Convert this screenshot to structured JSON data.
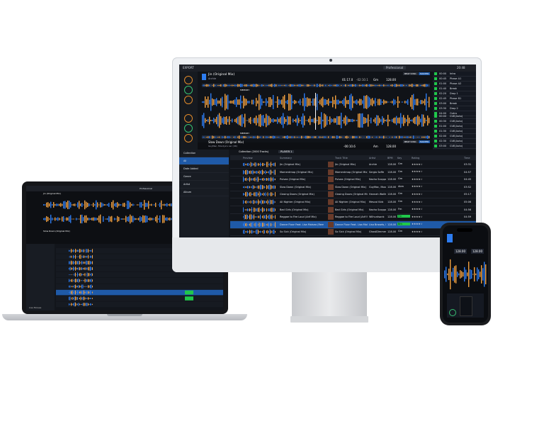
{
  "monitor": {
    "toolbar": {
      "export_label": "EXPORT",
      "mode": "Professional",
      "time": "20:48"
    },
    "deck1": {
      "title": "Jin (Original Mix)",
      "artist": "Archie",
      "elapsed": "01:17.0",
      "remain": "-02:10.1",
      "key": "Gm",
      "bpm": "128.00",
      "beat_sync": "BEAT SYNC",
      "master": "MASTER",
      "memory": "MEMORY",
      "cue": "CUE"
    },
    "deck2": {
      "title": "Slow Down (Original Mix)",
      "artist": "GuyMac, Moodys's Lar (UK)",
      "elapsed": "-00:10.6",
      "key": "Am",
      "bpm": "128.00",
      "beat_sync": "BEAT SYNC",
      "master": "MASTER",
      "memory": "MEMORY"
    },
    "hot_cues": [
      {
        "time": "00:00",
        "label": "Intro"
      },
      {
        "time": "00:45",
        "label": "Phase A1"
      },
      {
        "time": "01:00",
        "label": "Phase A2"
      },
      {
        "time": "01:40",
        "label": "Break"
      },
      {
        "time": "02:20",
        "label": "Drop 1"
      },
      {
        "time": "02:45",
        "label": "Phase B1"
      },
      {
        "time": "03:00",
        "label": "Break"
      },
      {
        "time": "03:30",
        "label": "Drop 2"
      },
      {
        "time": "04:00",
        "label": "Outro"
      }
    ],
    "hot_cues_b": [
      {
        "time": "00:00",
        "label": "CUE(Auto)"
      },
      {
        "time": "00:30",
        "label": "CUE(Auto)"
      },
      {
        "time": "01:00",
        "label": "CUE(Auto)"
      },
      {
        "time": "01:30",
        "label": "CUE(Auto)"
      },
      {
        "time": "02:00",
        "label": "CUE(Auto)"
      },
      {
        "time": "02:30",
        "label": "CUE(Auto)"
      },
      {
        "time": "03:00",
        "label": "CUE(Auto)"
      }
    ],
    "browser": {
      "tree_items": [
        "Collection",
        "All",
        "Date Added",
        "Genre",
        "Artist",
        "Album"
      ],
      "header": "Collection (2000 Tracks)",
      "player_label": "PLAYER 1",
      "columns": [
        "Preview",
        "Summary",
        "Track Title",
        "Artist",
        "BPM",
        "Key",
        "Rating",
        "Time"
      ],
      "rows": [
        {
          "summary": "Jin (Original Mix)",
          "title": "Jin (Original Mix)",
          "artist": "Archie",
          "bpm": "128.00",
          "key": "Gm",
          "time": "03:31"
        },
        {
          "summary": "Momentmap (Original Mix)",
          "title": "Momentmap (Original Mix)",
          "artist": "Sergio Saffe",
          "bpm": "128.00",
          "key": "Gm",
          "time": "04:57"
        },
        {
          "summary": "Pulsea (Original Mix)",
          "title": "Pulsea (Original Mix)",
          "artist": "Nacho Scoppa",
          "bpm": "128.00",
          "key": "Gm",
          "time": "04:45"
        },
        {
          "summary": "Slow Down (Original Mix)",
          "title": "Slow Down (Original Mix)",
          "artist": "GuyMac, Moodys's L",
          "bpm": "128.00",
          "key": "Abm",
          "time": "03:52"
        },
        {
          "summary": "Closing Doors (Original Mix)",
          "title": "Closing Doors (Original Mix)",
          "artist": "Hannah Wallis",
          "bpm": "128.00",
          "key": "Gm",
          "time": "05:17"
        },
        {
          "summary": "All Nighter (Original Mix)",
          "title": "All Nighter (Original Mix)",
          "artist": "Mescal Kids",
          "bpm": "128.00",
          "key": "Gm",
          "time": "05:06"
        },
        {
          "summary": "Bad Girls (Original Mix)",
          "title": "Bad Girls (Original Mix)",
          "artist": "Nacho Scoppa",
          "bpm": "128.00",
          "key": "Fm",
          "time": "04:56"
        },
        {
          "summary": "Reggae to Fire Loud (Arif Mix)",
          "title": "Reggae to Fire Loud (Arif Mix)",
          "artist": "Wilhuntsonk",
          "bpm": "128.00",
          "key": "Fm",
          "time": "04:59"
        },
        {
          "summary": "Dance Floor Feat. Lisa Moisea (Remix)",
          "title": "Dance Floor Feat. Lisa Moisea (Remix)",
          "artist": "Lisa Brasets, House",
          "bpm": "128.00",
          "key": "Bm",
          "time": "04:13"
        },
        {
          "summary": "So Sick (Original Mix)",
          "title": "So Sick (Original Mix)",
          "artist": "GhostDimmer's",
          "bpm": "128.00",
          "key": "Gm",
          "time": "05:08"
        }
      ]
    }
  },
  "laptop": {
    "toolbar": {
      "mode": "Professional"
    },
    "deck1": {
      "title": "Jin (Original Mix)"
    },
    "deck2": {
      "title": "Slow Down (Original Mix)"
    },
    "footer": "Lisa Moisea"
  },
  "phone": {
    "bpm_a": "128.00",
    "bpm_b": "128.00"
  },
  "colors": {
    "accent_blue": "#1f5aa8",
    "key_green": "#20c74b",
    "wave_orange": "#f0a040",
    "wave_blue": "#2d7cf0"
  }
}
